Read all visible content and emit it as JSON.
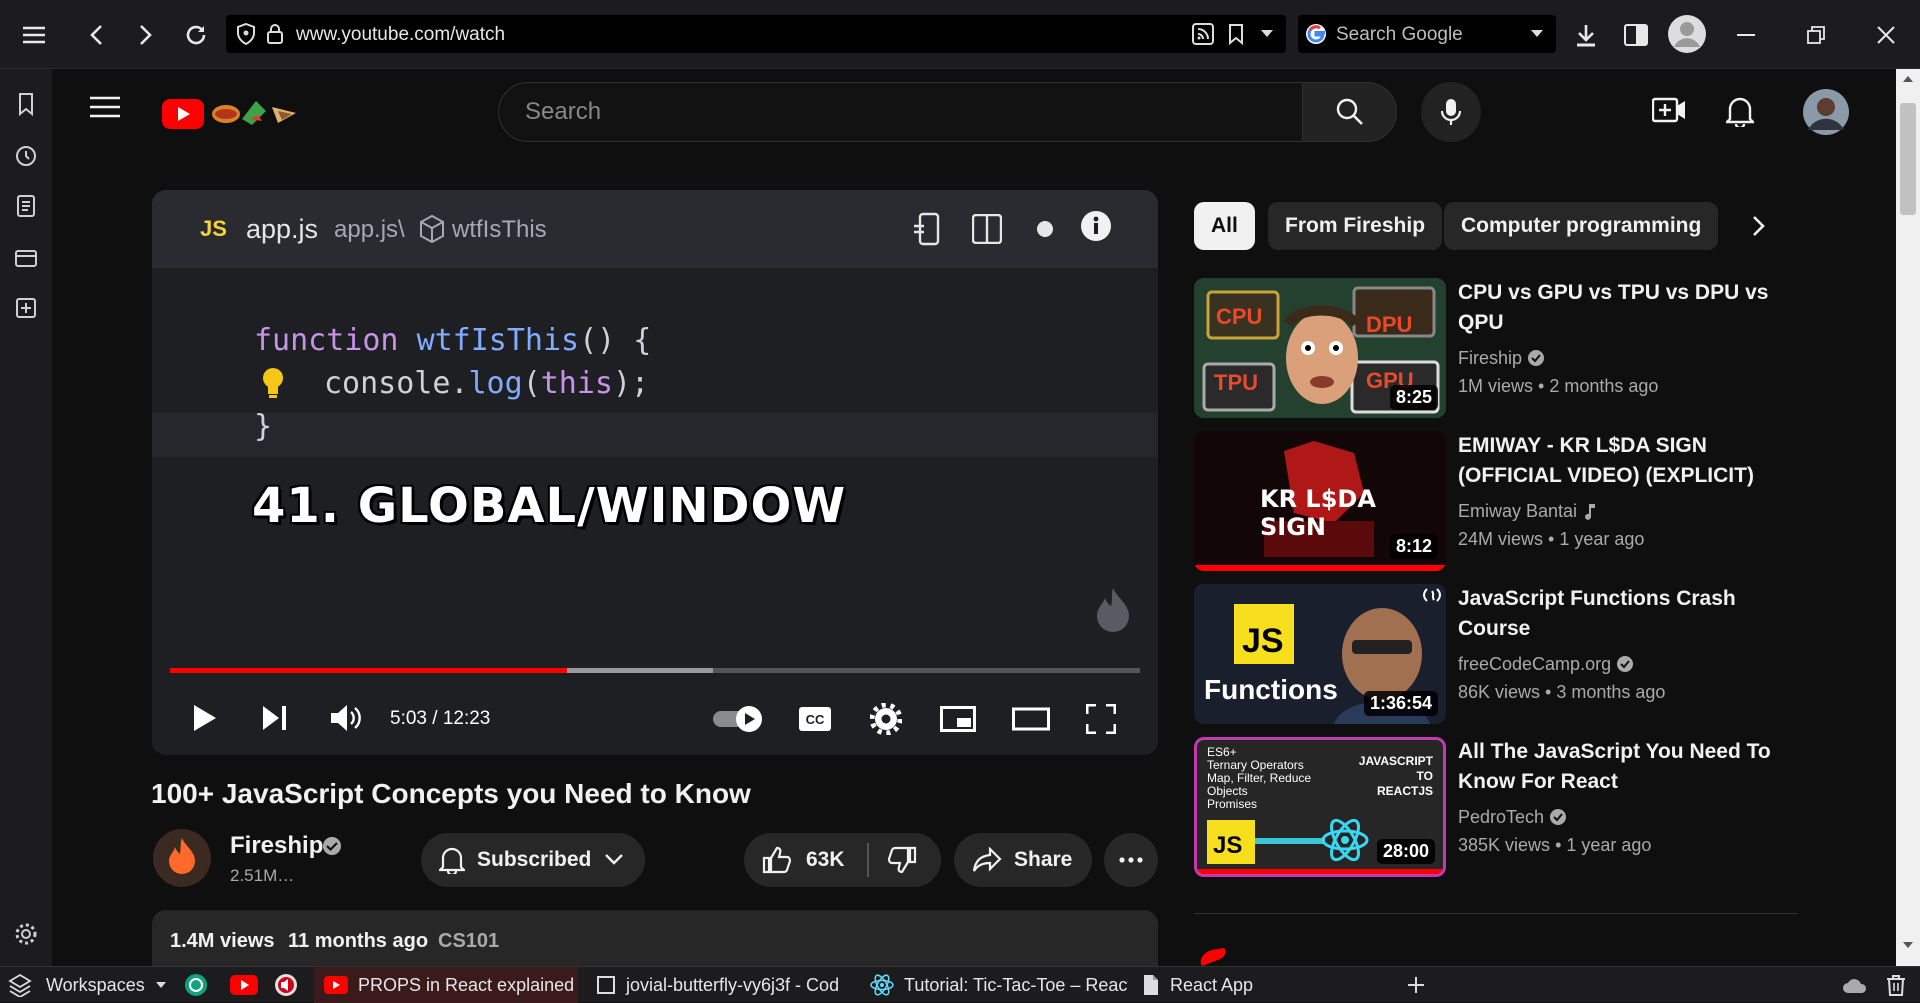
{
  "browser": {
    "url": "www.youtube.com/watch",
    "search_placeholder": "Search Google"
  },
  "youtube": {
    "search_placeholder": "Search",
    "player": {
      "file_tab": "app.js",
      "breadcrumb_file": "app.js\\",
      "breadcrumb_symbol": "wtfIsThis",
      "js_badge": "JS",
      "code_line1_kw": "function",
      "code_line1_fn": "wtfIsThis",
      "code_line1_rest": "() {",
      "code_line2_obj": "console.",
      "code_line2_method": "log",
      "code_line2_paren_open": "(",
      "code_line2_this": "this",
      "code_line2_end": ");",
      "code_line3": "}",
      "overlay_title": "41. GLOBAL/WINDOW",
      "time": "5:03 / 12:23",
      "progress_fraction": 0.409,
      "buffer_fraction": 0.56
    },
    "video": {
      "title": "100+ JavaScript Concepts you Need to Know",
      "channel": "Fireship",
      "subscribers": "2.51M…",
      "subscribed_label": "Subscribed",
      "likes": "63K",
      "share_label": "Share",
      "views": "1.4M views",
      "age": "11 months ago",
      "tag": "CS101"
    },
    "chips": [
      "All",
      "From Fireship",
      "Computer programming"
    ],
    "recommendations": [
      {
        "title": "CPU vs GPU vs TPU vs DPU vs QPU",
        "channel": "Fireship",
        "views": "1M views",
        "age": "2 months ago",
        "duration": "8:25",
        "thumb_labels": [
          "CPU",
          "DPU",
          "TPU",
          "GPU"
        ]
      },
      {
        "title": "EMIWAY - KR L$DA SIGN (OFFICIAL VIDEO) (EXPLICIT)",
        "channel": "Emiway Bantai",
        "views": "24M views",
        "age": "1 year ago",
        "duration": "8:12",
        "thumb_labels": [
          "KR L$DA SIGN"
        ]
      },
      {
        "title": "JavaScript Functions Crash Course",
        "channel": "freeCodeCamp.org",
        "views": "86K views",
        "age": "3 months ago",
        "duration": "1:36:54",
        "thumb_labels": [
          "JS",
          "Functions"
        ]
      },
      {
        "title": "All The JavaScript You Need To Know For React",
        "channel": "PedroTech",
        "views": "385K views",
        "age": "1 year ago",
        "duration": "28:00",
        "thumb_labels": [
          "ES6+",
          "Ternary Operators",
          "Map, Filter, Reduce",
          "Objects",
          "Promises",
          "JAVASCRIPT",
          "TO",
          "REACTJS",
          "JS"
        ]
      }
    ]
  },
  "taskbar": {
    "workspaces_label": "Workspaces",
    "tabs": [
      "PROPS in React explained",
      "jovial-butterfly-vy6j3f - Cod",
      "Tutorial: Tic-Tac-Toe – React",
      "React App"
    ]
  }
}
